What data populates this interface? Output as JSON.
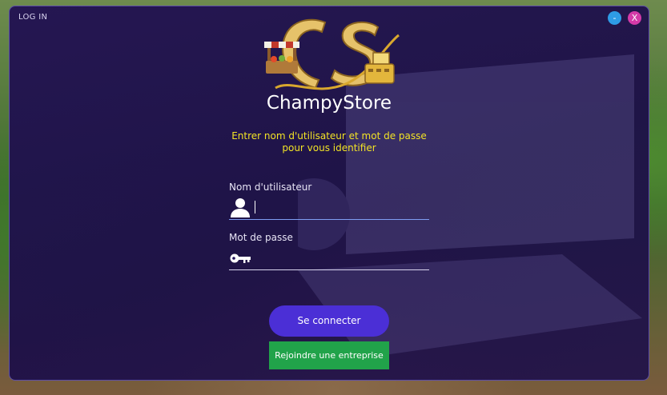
{
  "window": {
    "title": "LOG IN",
    "minimize_label": "-",
    "close_label": "X"
  },
  "brand": {
    "name": "ChampyStore"
  },
  "login": {
    "instructions_line1": "Entrer nom d'utilisateur et mot de passe",
    "instructions_line2": "pour vous identifier",
    "username_label": "Nom d'utilisateur",
    "username_value": "",
    "password_label": "Mot de passe",
    "password_value": "",
    "connect_label": "Se connecter",
    "join_label": "Rejoindre une entreprise"
  },
  "colors": {
    "accent_yellow": "#f2e325",
    "connect_button": "#4b2fd6",
    "join_button": "#21a34a",
    "minimize_button": "#2e9be6",
    "close_button": "#d43aa8",
    "window_background": "#22125a"
  },
  "icons": {
    "username": "user-icon",
    "password": "key-icon",
    "logo": "champystore-logo"
  }
}
